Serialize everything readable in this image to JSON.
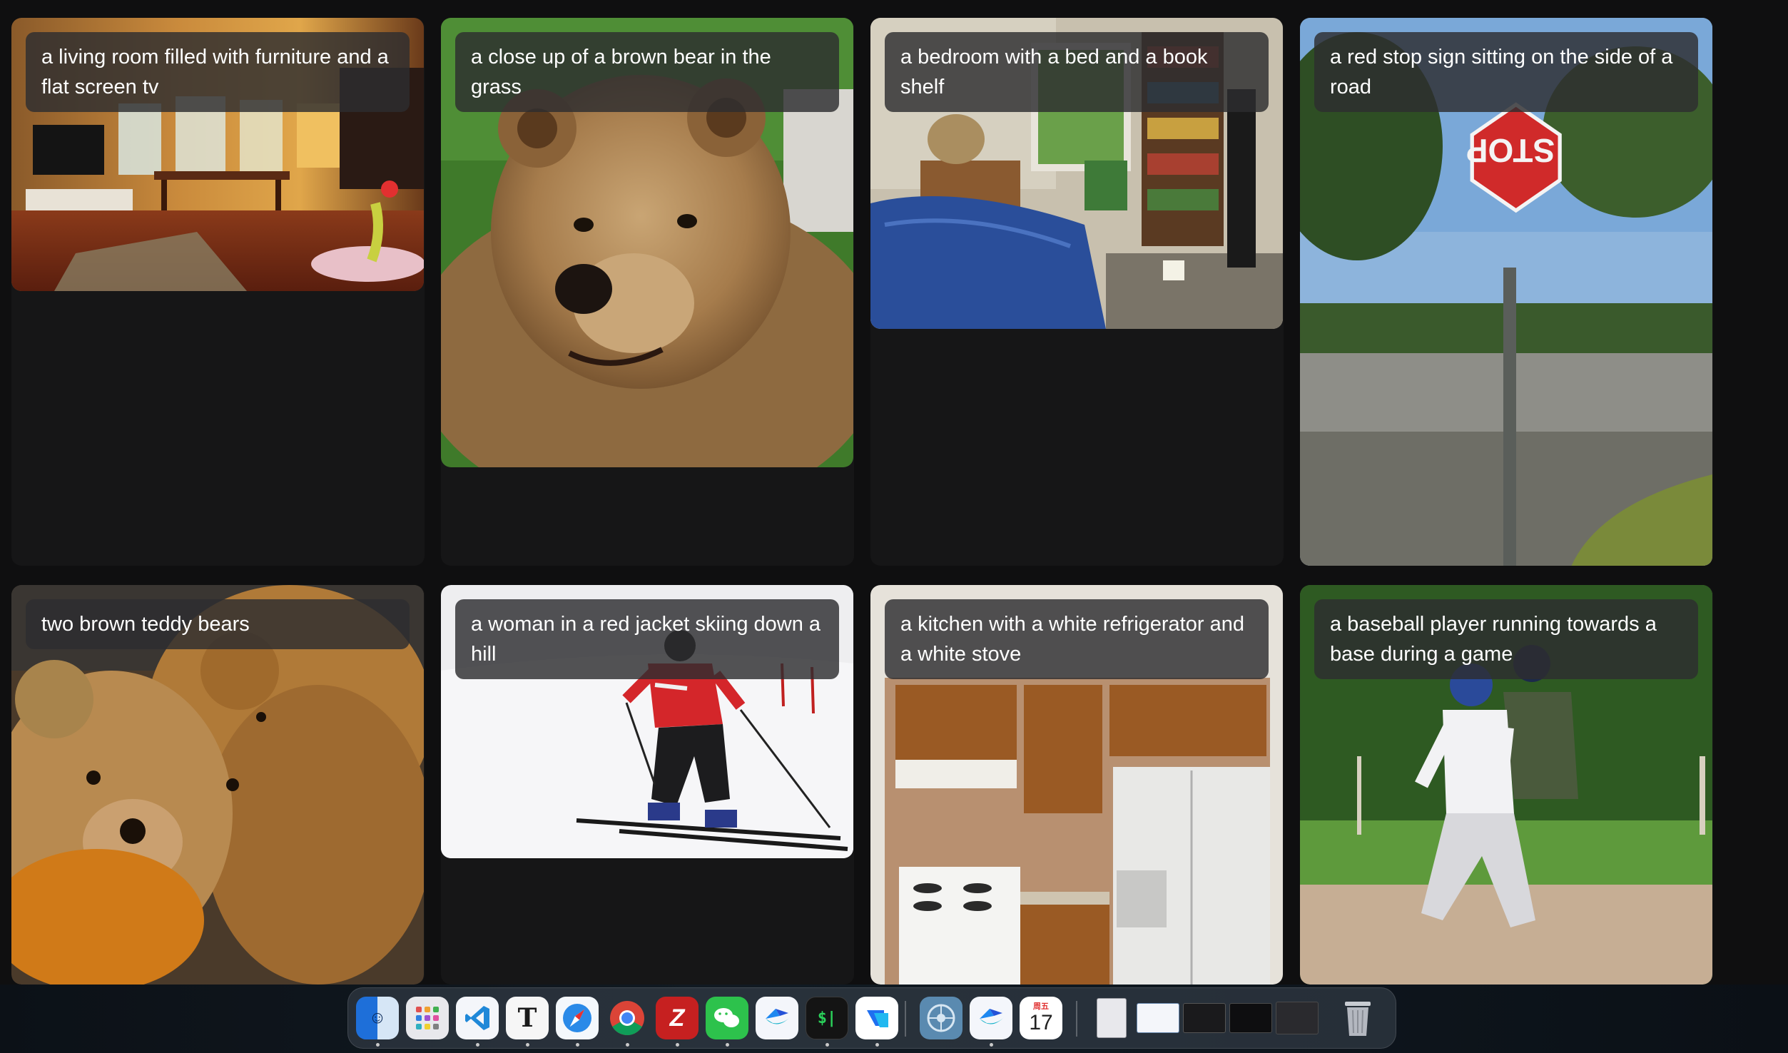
{
  "gallery": {
    "cards": [
      {
        "caption": "a living room filled with furniture and a flat screen tv"
      },
      {
        "caption": "a close up of a brown bear in the grass"
      },
      {
        "caption": "a bedroom with a bed and a book shelf"
      },
      {
        "caption": "a red stop sign sitting on the side of a road"
      },
      {
        "caption": "two brown teddy bears"
      },
      {
        "caption": "a woman in a red jacket skiing down a hill"
      },
      {
        "caption": "a kitchen with a white refrigerator and a white stove"
      },
      {
        "caption": "a baseball player running towards a base during a game"
      }
    ],
    "stop_sign_text": "STOP"
  },
  "dock": {
    "items": [
      {
        "icon": "finder-icon"
      },
      {
        "icon": "launchpad-icon"
      },
      {
        "icon": "vscode-icon"
      },
      {
        "icon": "typora-icon",
        "glyph": "T"
      },
      {
        "icon": "safari-icon"
      },
      {
        "icon": "chrome-icon"
      },
      {
        "icon": "filezilla-icon"
      },
      {
        "icon": "wechat-icon"
      },
      {
        "icon": "lark-icon"
      },
      {
        "icon": "terminal-icon",
        "glyph": "$|"
      },
      {
        "icon": "tencent-meeting-icon"
      },
      {
        "icon": "network-icon"
      },
      {
        "icon": "lark-alt-icon"
      },
      {
        "icon": "calendar-icon",
        "weekday": "周五",
        "day": "17"
      },
      {
        "icon": "document-thumbnail-icon"
      },
      {
        "icon": "window-thumbnail-icon"
      },
      {
        "icon": "typora-window-thumbnail-icon"
      },
      {
        "icon": "terminal-window-thumbnail-icon"
      },
      {
        "icon": "wechat-window-thumbnail-icon"
      },
      {
        "icon": "trash-icon"
      }
    ]
  }
}
